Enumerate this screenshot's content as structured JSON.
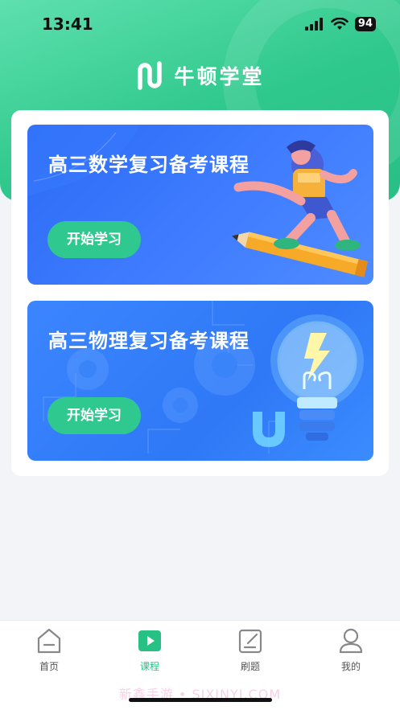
{
  "status_bar": {
    "time": "13:41",
    "battery": "94"
  },
  "brand": {
    "name": "牛顿学堂"
  },
  "courses": [
    {
      "title": "高三数学复习备考课程",
      "button": "开始学习"
    },
    {
      "title": "高三物理复习备考课程",
      "button": "开始学习"
    }
  ],
  "tabbar": {
    "items": [
      {
        "label": "首页",
        "icon": "home-icon"
      },
      {
        "label": "课程",
        "icon": "video-icon"
      },
      {
        "label": "刷题",
        "icon": "edit-icon"
      },
      {
        "label": "我的",
        "icon": "user-icon"
      }
    ],
    "active": "课程"
  },
  "watermark": "新鑫手游 • SIXINYI.COM",
  "colors": {
    "brand_green": "#2fc98f",
    "course_blue": "#3577f8",
    "active_tab": "#27c184"
  }
}
